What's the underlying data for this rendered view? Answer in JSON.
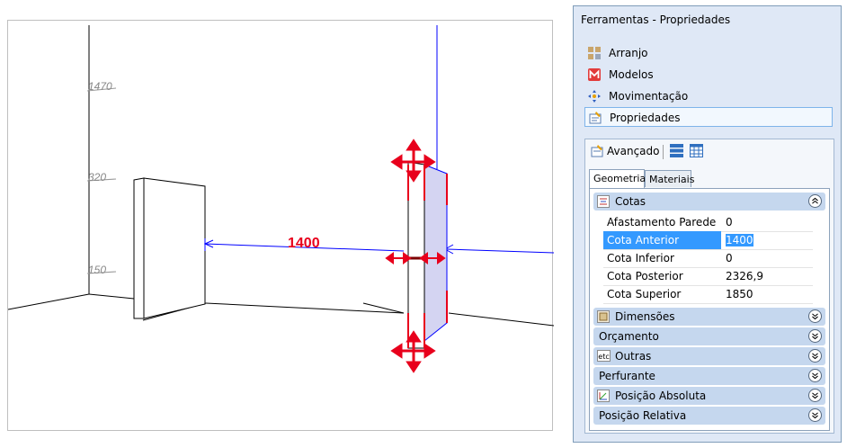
{
  "viewport": {
    "dim_label": "1400",
    "height_marks": [
      "1470",
      "320",
      "150"
    ]
  },
  "panel": {
    "title": "Ferramentas - Propriedades",
    "nav_items": [
      {
        "label": "Arranjo",
        "icon": "grid-icon"
      },
      {
        "label": "Modelos",
        "icon": "models-m-icon"
      },
      {
        "label": "Movimentação",
        "icon": "move-icon"
      },
      {
        "label": "Propriedades",
        "icon": "properties-icon",
        "selected": true
      }
    ],
    "sub": {
      "title": "Avançado",
      "tabs": [
        "Geometria",
        "Materiais"
      ],
      "active_tab": "Geometria",
      "sections": [
        {
          "label": "Cotas",
          "expanded": true,
          "rows": [
            {
              "name": "Afastamento Parede",
              "value": "0"
            },
            {
              "name": "Cota Anterior",
              "value": "1400",
              "selected": true
            },
            {
              "name": "Cota Inferior",
              "value": "0"
            },
            {
              "name": "Cota Posterior",
              "value": "2326,9"
            },
            {
              "name": "Cota Superior",
              "value": "1850"
            }
          ]
        },
        {
          "label": "Dimensões"
        },
        {
          "label": "Orçamento"
        },
        {
          "label": "Outras",
          "icon_text": "etc"
        },
        {
          "label": "Perfurante"
        },
        {
          "label": "Posição Absoluta"
        },
        {
          "label": "Posição Relativa"
        }
      ]
    }
  },
  "colors": {
    "dimension_red": "#e8001c",
    "blue_lines": "#0000ff",
    "panel_fill": "#d4d4f2",
    "header_bg": "#c5d7ee",
    "selection_blue": "#3399ff"
  }
}
